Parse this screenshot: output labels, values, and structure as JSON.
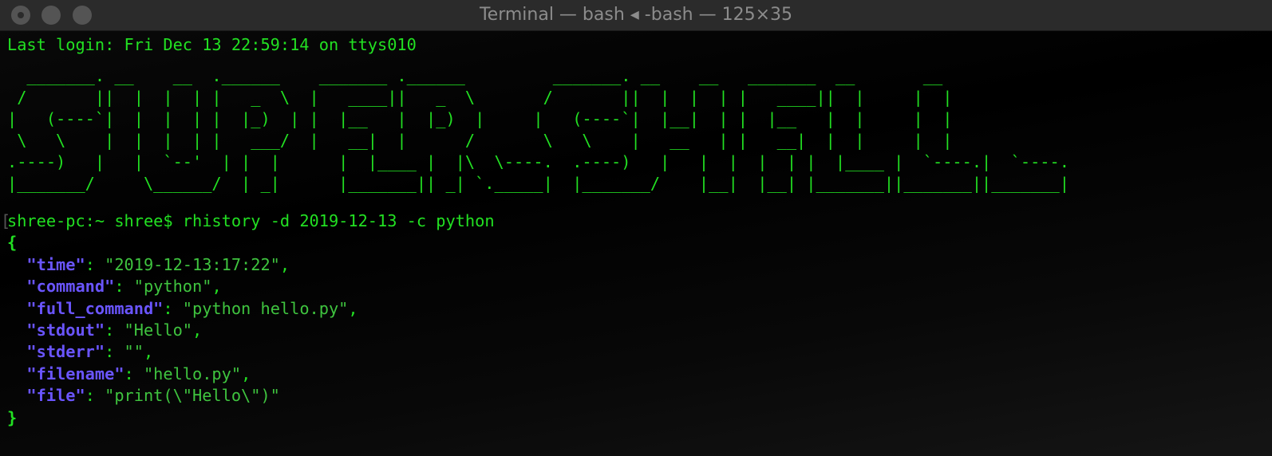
{
  "window": {
    "title": "Terminal — bash ◂ -bash — 125×35"
  },
  "terminal": {
    "last_login": "Last login: Fri Dec 13 22:59:14 on ttys010",
    "banner_art": "  _______. __    __  .______    _______ .______         _______. __    __   _______  __       __\n /       ||  |  |  | |   _  \\  |   ____||   _  \\       /       ||  |  |  | |   ____||  |     |  |\n|   (----`|  |  |  | |  |_)  | |  |__   |  |_)  |     |   (----`|  |__|  | |  |__   |  |     |  |\n \\   \\    |  |  |  | |   ___/  |   __|  |      /       \\   \\    |   __   | |   __|  |  |     |  |\n.----)   |   |  `--'  | |  |      |  |____ |  |\\  \\----.  .----)   |   |  |  |  | |  |____ |  `----.|  `----.\n|_______/     \\______/  | _|      |_______|| _| `._____|  |_______/    |__|  |__| |_______||_______||_______|",
    "prompt": "shree-pc:~ shree$ ",
    "command": "rhistory -d 2019-12-13 -c python",
    "open_brace": "{",
    "close_brace": "}",
    "json_output": [
      {
        "key": "\"time\"",
        "value": "\"2019-12-13:17:22\"",
        "trail": ","
      },
      {
        "key": "\"command\"",
        "value": "\"python\"",
        "trail": ","
      },
      {
        "key": "\"full_command\"",
        "value": "\"python hello.py\"",
        "trail": ","
      },
      {
        "key": "\"stdout\"",
        "value": "\"Hello\"",
        "trail": ","
      },
      {
        "key": "\"stderr\"",
        "value": "\"\"",
        "trail": ","
      },
      {
        "key": "\"filename\"",
        "value": "\"hello.py\"",
        "trail": ","
      },
      {
        "key": "\"file\"",
        "value": "\"print(\\\"Hello\\\")\"",
        "trail": ""
      }
    ]
  },
  "colors": {
    "text_green": "#22e022",
    "json_key": "#6a55ff",
    "json_value": "#3fc43f",
    "background": "#000000",
    "titlebar": "#2b2b2b"
  }
}
